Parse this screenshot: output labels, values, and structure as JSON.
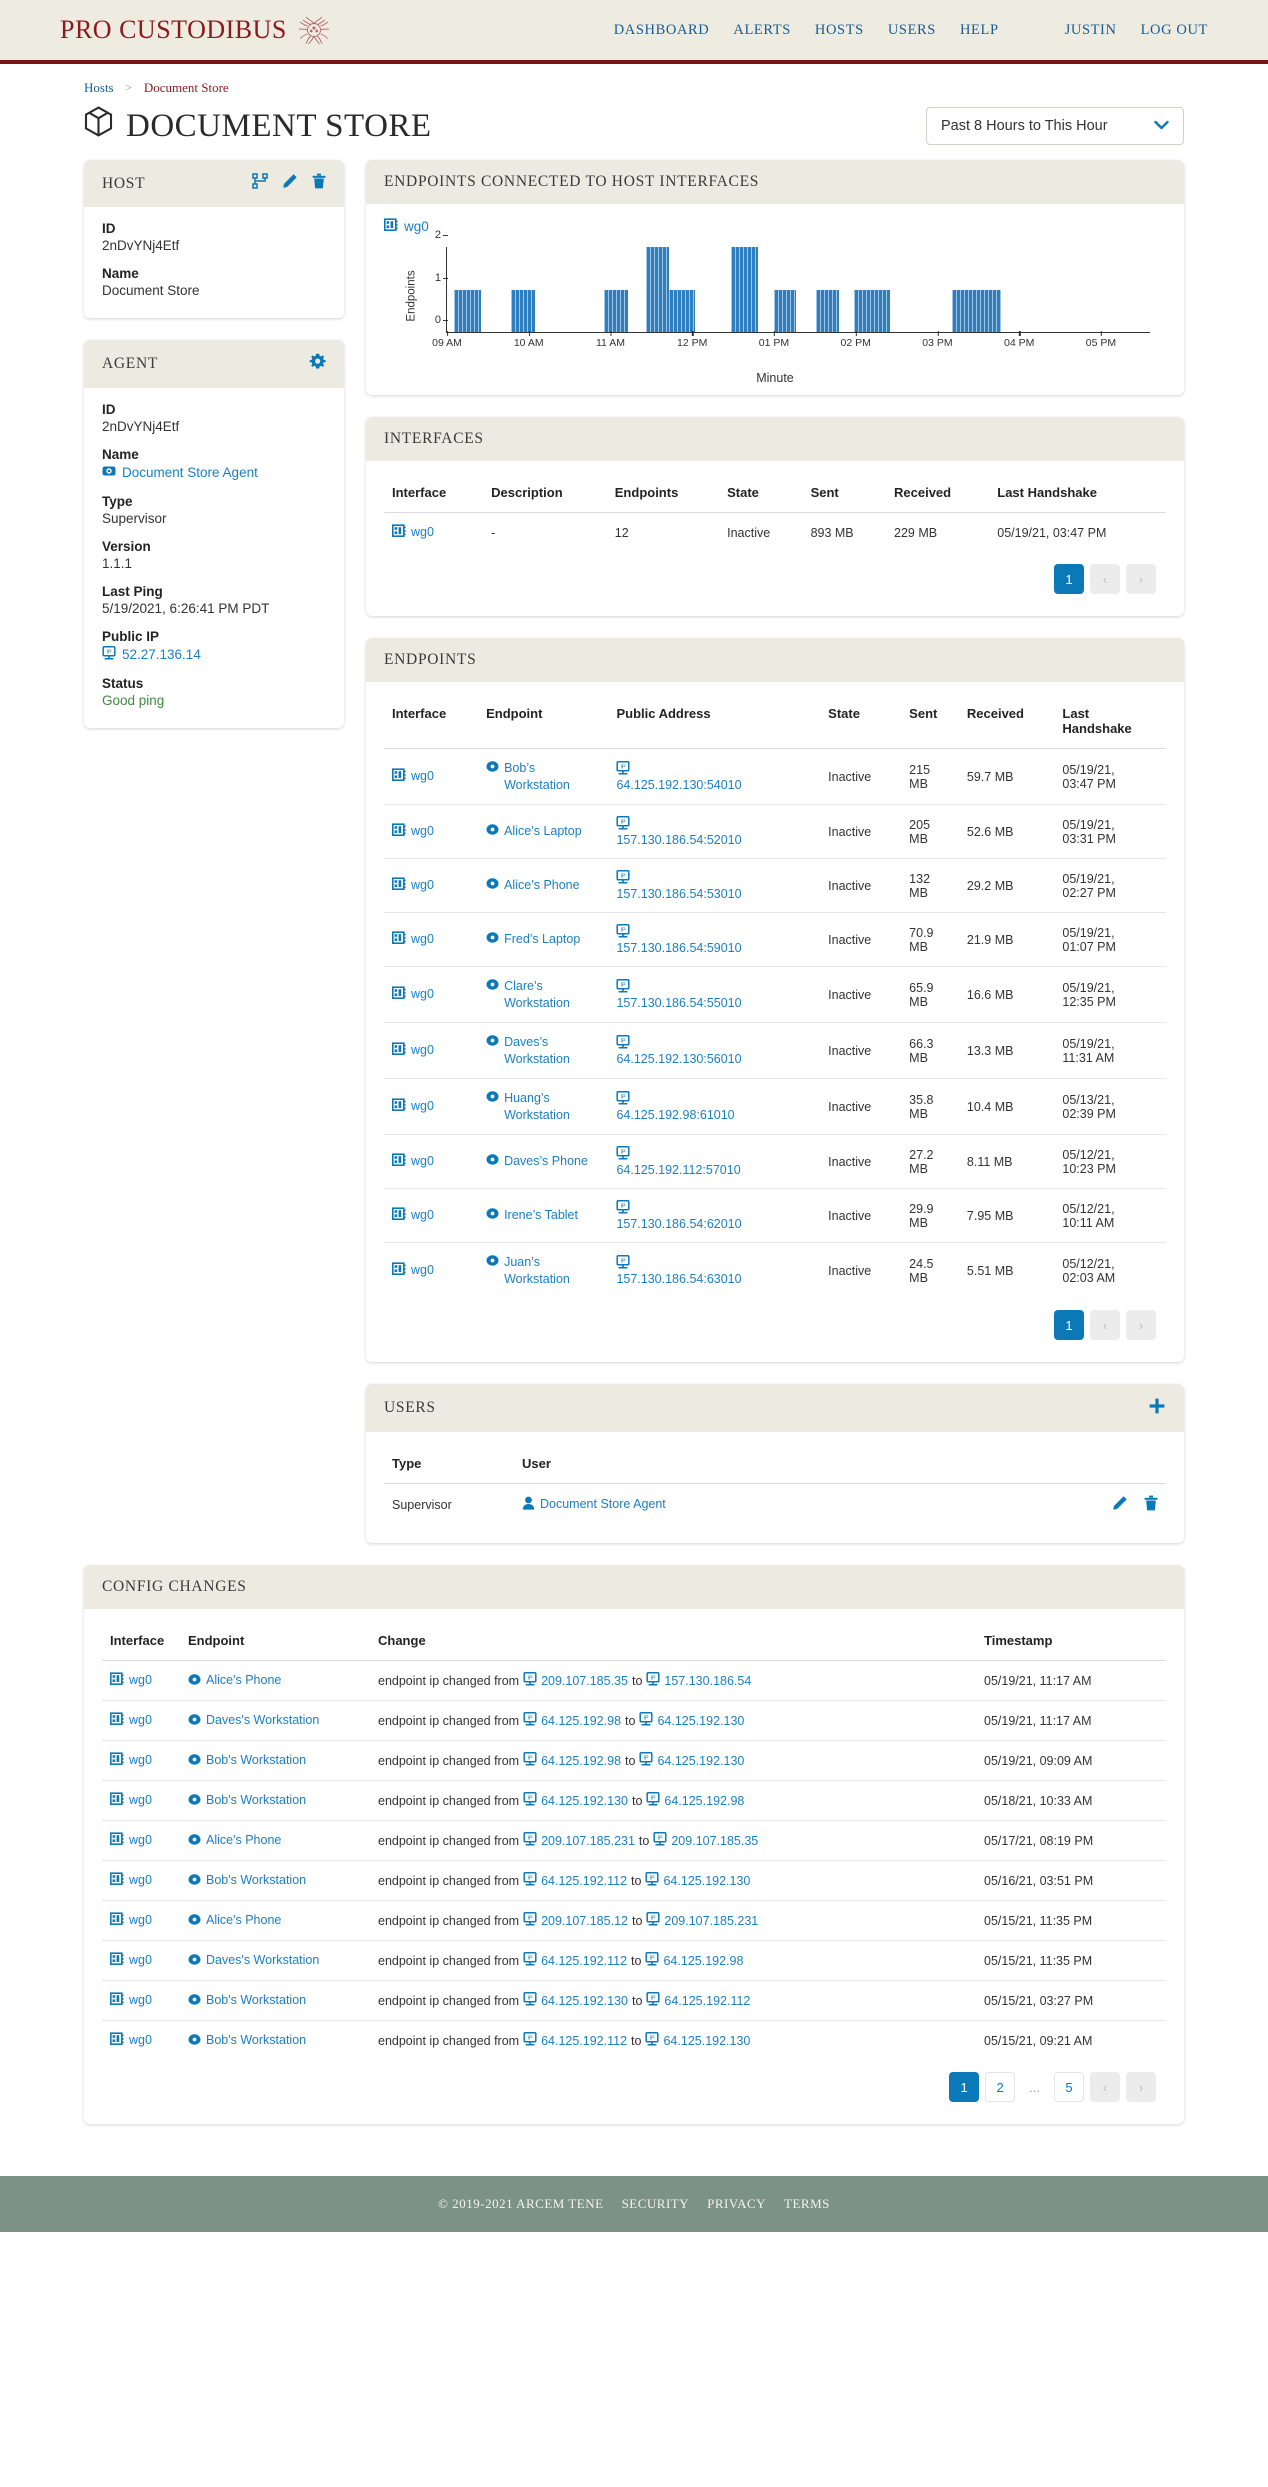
{
  "nav": {
    "brand": "PRO CUSTODIBUS",
    "brand_mark_icon": "medusa-emblem-icon",
    "links": [
      "DASHBOARD",
      "ALERTS",
      "HOSTS",
      "USERS",
      "HELP"
    ],
    "user": "JUSTIN",
    "logout": "LOG OUT"
  },
  "breadcrumb": {
    "parent": "Hosts",
    "separator": ">",
    "current": "Document Store"
  },
  "page": {
    "title": "DOCUMENT STORE",
    "title_icon": "cube-icon",
    "range_selector": {
      "value": "Past 8 Hours to This Hour",
      "chevron": "chevron-down-icon"
    }
  },
  "host_card": {
    "title": "HOST",
    "actions": [
      "network-graph-icon",
      "pencil-icon",
      "trash-icon"
    ],
    "fields": [
      {
        "label": "ID",
        "value": "2nDvYNj4Etf"
      },
      {
        "label": "Name",
        "value": "Document Store"
      }
    ]
  },
  "agent_card": {
    "title": "AGENT",
    "actions": [
      "gear-icon"
    ],
    "id_label": "ID",
    "id_value": "2nDvYNj4Etf",
    "name_label": "Name",
    "name_value": "Document Store Agent",
    "type_label": "Type",
    "type_value": "Supervisor",
    "version_label": "Version",
    "version_value": "1.1.1",
    "last_ping_label": "Last Ping",
    "last_ping_value": "5/19/2021, 6:26:41 PM PDT",
    "public_ip_label": "Public IP",
    "public_ip_value": "52.27.136.14",
    "status_label": "Status",
    "status_value": "Good ping"
  },
  "chart_card": {
    "title": "ENDPOINTS CONNECTED TO HOST INTERFACES",
    "legend": "wg0"
  },
  "chart_data": {
    "type": "bar",
    "title": "ENDPOINTS CONNECTED TO HOST INTERFACES",
    "series_name": "wg0",
    "xlabel": "Minute",
    "ylabel": "Endpoints",
    "ylim": [
      0,
      2
    ],
    "yticks": [
      0,
      1,
      2
    ],
    "xticks": [
      "09 AM",
      "10 AM",
      "11 AM",
      "12 PM",
      "01 PM",
      "02 PM",
      "03 PM",
      "04 PM",
      "05 PM"
    ],
    "xlim_hours": [
      9,
      17.6
    ],
    "grid": false,
    "legend_position": "top-left",
    "bars": [
      {
        "start_hour": 9.08,
        "end_hour": 9.42,
        "value": 1
      },
      {
        "start_hour": 9.78,
        "end_hour": 10.08,
        "value": 1
      },
      {
        "start_hour": 10.92,
        "end_hour": 11.22,
        "value": 1
      },
      {
        "start_hour": 11.43,
        "end_hour": 11.72,
        "value": 2
      },
      {
        "start_hour": 11.72,
        "end_hour": 12.03,
        "value": 1
      },
      {
        "start_hour": 12.47,
        "end_hour": 12.8,
        "value": 2
      },
      {
        "start_hour": 13.0,
        "end_hour": 13.27,
        "value": 1
      },
      {
        "start_hour": 13.52,
        "end_hour": 13.8,
        "value": 1
      },
      {
        "start_hour": 13.98,
        "end_hour": 14.42,
        "value": 1
      },
      {
        "start_hour": 15.18,
        "end_hour": 15.78,
        "value": 1
      }
    ]
  },
  "interfaces_card": {
    "title": "INTERFACES",
    "columns": [
      "Interface",
      "Description",
      "Endpoints",
      "State",
      "Sent",
      "Received",
      "Last Handshake"
    ],
    "rows": [
      {
        "interface": "wg0",
        "interface_icon": "interface-icon",
        "description": "-",
        "endpoints": "12",
        "state": "Inactive",
        "sent": "893 MB",
        "received": "229 MB",
        "last_handshake": "05/19/21, 03:47 PM"
      }
    ],
    "pagination": {
      "pages": [
        "1"
      ],
      "active": "1",
      "prev": "‹",
      "next": "›"
    }
  },
  "endpoints_card": {
    "title": "ENDPOINTS",
    "columns": [
      "Interface",
      "Endpoint",
      "Public Address",
      "State",
      "Sent",
      "Received",
      "Last Handshake"
    ],
    "rows": [
      {
        "interface": "wg0",
        "endpoint": "Bob’s Workstation",
        "address": "64.125.192.130:54010",
        "state": "Inactive",
        "sent": "215 MB",
        "received": "59.7 MB",
        "last_handshake": "05/19/21, 03:47 PM"
      },
      {
        "interface": "wg0",
        "endpoint": "Alice’s Laptop",
        "address": "157.130.186.54:52010",
        "state": "Inactive",
        "sent": "205 MB",
        "received": "52.6 MB",
        "last_handshake": "05/19/21, 03:31 PM"
      },
      {
        "interface": "wg0",
        "endpoint": "Alice’s Phone",
        "address": "157.130.186.54:53010",
        "state": "Inactive",
        "sent": "132 MB",
        "received": "29.2 MB",
        "last_handshake": "05/19/21, 02:27 PM"
      },
      {
        "interface": "wg0",
        "endpoint": "Fred’s Laptop",
        "address": "157.130.186.54:59010",
        "state": "Inactive",
        "sent": "70.9 MB",
        "received": "21.9 MB",
        "last_handshake": "05/19/21, 01:07 PM"
      },
      {
        "interface": "wg0",
        "endpoint": "Clare’s Workstation",
        "address": "157.130.186.54:55010",
        "state": "Inactive",
        "sent": "65.9 MB",
        "received": "16.6 MB",
        "last_handshake": "05/19/21, 12:35 PM"
      },
      {
        "interface": "wg0",
        "endpoint": "Daves’s Workstation",
        "address": "64.125.192.130:56010",
        "state": "Inactive",
        "sent": "66.3 MB",
        "received": "13.3 MB",
        "last_handshake": "05/19/21, 11:31 AM"
      },
      {
        "interface": "wg0",
        "endpoint": "Huang’s Workstation",
        "address": "64.125.192.98:61010",
        "state": "Inactive",
        "sent": "35.8 MB",
        "received": "10.4 MB",
        "last_handshake": "05/13/21, 02:39 PM"
      },
      {
        "interface": "wg0",
        "endpoint": "Daves’s Phone",
        "address": "64.125.192.112:57010",
        "state": "Inactive",
        "sent": "27.2 MB",
        "received": "8.11 MB",
        "last_handshake": "05/12/21, 10:23 PM"
      },
      {
        "interface": "wg0",
        "endpoint": "Irene’s Tablet",
        "address": "157.130.186.54:62010",
        "state": "Inactive",
        "sent": "29.9 MB",
        "received": "7.95 MB",
        "last_handshake": "05/12/21, 10:11 AM"
      },
      {
        "interface": "wg0",
        "endpoint": "Juan’s Workstation",
        "address": "157.130.186.54:63010",
        "state": "Inactive",
        "sent": "24.5 MB",
        "received": "5.51 MB",
        "last_handshake": "05/12/21, 02:03 AM"
      }
    ],
    "pagination": {
      "pages": [
        "1"
      ],
      "active": "1",
      "prev": "‹",
      "next": "›"
    }
  },
  "users_card": {
    "title": "USERS",
    "add_icon": "plus-icon",
    "columns": [
      "Type",
      "User"
    ],
    "rows": [
      {
        "type": "Supervisor",
        "user": "Document Store Agent",
        "user_icon": "person-icon",
        "actions": [
          "pencil-icon",
          "trash-icon"
        ]
      }
    ]
  },
  "config_changes_card": {
    "title": "CONFIG CHANGES",
    "columns": [
      "Interface",
      "Endpoint",
      "Change",
      "Timestamp"
    ],
    "change_prefix": "endpoint ip changed from",
    "change_joiner": "to",
    "rows": [
      {
        "interface": "wg0",
        "endpoint": "Alice's Phone",
        "from": "209.107.185.35",
        "to": "157.130.186.54",
        "timestamp": "05/19/21, 11:17 AM"
      },
      {
        "interface": "wg0",
        "endpoint": "Daves's Workstation",
        "from": "64.125.192.98",
        "to": "64.125.192.130",
        "timestamp": "05/19/21, 11:17 AM"
      },
      {
        "interface": "wg0",
        "endpoint": "Bob's Workstation",
        "from": "64.125.192.98",
        "to": "64.125.192.130",
        "timestamp": "05/19/21, 09:09 AM"
      },
      {
        "interface": "wg0",
        "endpoint": "Bob's Workstation",
        "from": "64.125.192.130",
        "to": "64.125.192.98",
        "timestamp": "05/18/21, 10:33 AM"
      },
      {
        "interface": "wg0",
        "endpoint": "Alice's Phone",
        "from": "209.107.185.231",
        "to": "209.107.185.35",
        "timestamp": "05/17/21, 08:19 PM"
      },
      {
        "interface": "wg0",
        "endpoint": "Bob's Workstation",
        "from": "64.125.192.112",
        "to": "64.125.192.130",
        "timestamp": "05/16/21, 03:51 PM"
      },
      {
        "interface": "wg0",
        "endpoint": "Alice's Phone",
        "from": "209.107.185.12",
        "to": "209.107.185.231",
        "timestamp": "05/15/21, 11:35 PM"
      },
      {
        "interface": "wg0",
        "endpoint": "Daves's Workstation",
        "from": "64.125.192.112",
        "to": "64.125.192.98",
        "timestamp": "05/15/21, 11:35 PM"
      },
      {
        "interface": "wg0",
        "endpoint": "Bob's Workstation",
        "from": "64.125.192.130",
        "to": "64.125.192.112",
        "timestamp": "05/15/21, 03:27 PM"
      },
      {
        "interface": "wg0",
        "endpoint": "Bob's Workstation",
        "from": "64.125.192.112",
        "to": "64.125.192.130",
        "timestamp": "05/15/21, 09:21 AM"
      }
    ],
    "pagination": {
      "pages": [
        "1",
        "2",
        "...",
        "5"
      ],
      "active": "1",
      "prev": "‹",
      "next": "›"
    }
  },
  "footer": {
    "copyright": "© 2019-2021 ARCEM TENE",
    "links": [
      "SECURITY",
      "PRIVACY",
      "TERMS"
    ]
  },
  "colors": {
    "brand_red": "#8b1a1c",
    "link_blue": "#1a7fc1",
    "accent_blue": "#0b78b8",
    "header_cream": "#eeebe1",
    "panel_cream": "#edebe1",
    "footer_green": "#7d9287",
    "bar_blue": "#2e7fc0",
    "status_green": "#3e8b3e"
  }
}
